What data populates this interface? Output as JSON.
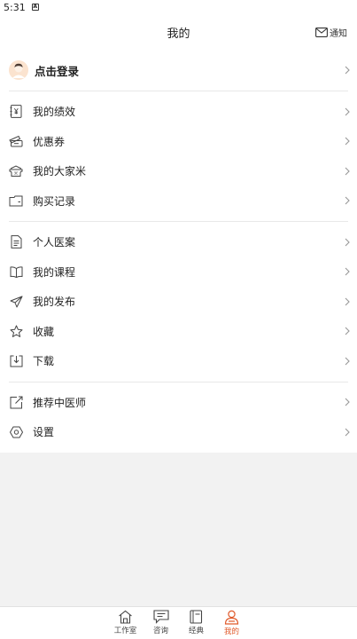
{
  "status_bar": {
    "time": "5:31",
    "notification_icon": "A"
  },
  "header": {
    "title": "我的",
    "notify_label": "通知"
  },
  "login": {
    "label": "点击登录"
  },
  "sections": [
    [
      {
        "name": "performance",
        "icon": "ledger-yen-icon",
        "label": "我的绩效"
      },
      {
        "name": "coupons",
        "icon": "coupon-icon",
        "label": "优惠券"
      },
      {
        "name": "rice",
        "icon": "rice-icon",
        "label": "我的大家米"
      },
      {
        "name": "purchase",
        "icon": "wallet-icon",
        "label": "购买记录"
      }
    ],
    [
      {
        "name": "medical-cases",
        "icon": "document-icon",
        "label": "个人医案"
      },
      {
        "name": "courses",
        "icon": "book-icon",
        "label": "我的课程"
      },
      {
        "name": "posts",
        "icon": "paper-plane-icon",
        "label": "我的发布"
      },
      {
        "name": "favorites",
        "icon": "star-icon",
        "label": "收藏"
      },
      {
        "name": "downloads",
        "icon": "download-icon",
        "label": "下载"
      }
    ],
    [
      {
        "name": "recommend-doctor",
        "icon": "share-icon",
        "label": "推荐中医师"
      },
      {
        "name": "settings",
        "icon": "gear-icon",
        "label": "设置"
      }
    ]
  ],
  "tabbar": {
    "tabs": [
      {
        "name": "studio",
        "icon": "home-icon",
        "label": "工作室",
        "active": false
      },
      {
        "name": "consult",
        "icon": "chat-icon",
        "label": "咨询",
        "active": false
      },
      {
        "name": "classics",
        "icon": "book-icon",
        "label": "经典",
        "active": false
      },
      {
        "name": "mine",
        "icon": "person-icon",
        "label": "我的",
        "active": true
      }
    ],
    "active_color": "#e05a2b"
  }
}
